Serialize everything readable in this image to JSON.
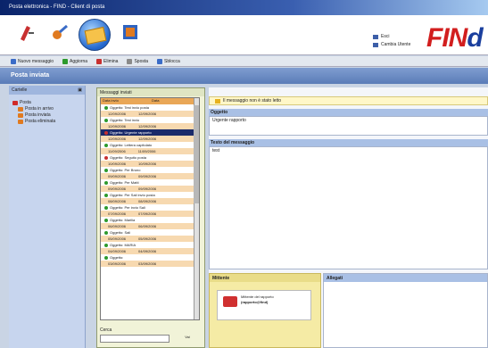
{
  "window": {
    "title": "Posta elettronica - FIND - Client di posta"
  },
  "toolbar": {
    "icons": [
      "compose-icon",
      "key-icon",
      "globe-mail-icon",
      "film-icon"
    ],
    "links": [
      "Esci",
      "Cambia Utente"
    ]
  },
  "logo": {
    "text_red": "FIN",
    "text_blue": "d"
  },
  "menu": {
    "items": [
      {
        "label": "Nuovo messaggio",
        "icon": "new-message-icon",
        "color": "#3b6cc7"
      },
      {
        "label": "Aggiorna",
        "icon": "refresh-icon",
        "color": "#2d9a2d"
      },
      {
        "label": "Elimina",
        "icon": "delete-icon",
        "color": "#c83030"
      },
      {
        "label": "Sposta",
        "icon": "move-icon",
        "color": "#8a8a8a"
      },
      {
        "label": "Sblocca",
        "icon": "unlock-icon",
        "color": "#3b6cc7"
      }
    ]
  },
  "page": {
    "title": "Posta inviata"
  },
  "sidebar": {
    "header": "Cartelle",
    "tree": [
      {
        "label": "Posta",
        "level": 0,
        "color": "#d02a2a"
      },
      {
        "label": "Posta in arrivo",
        "level": 1,
        "color": "#e07a20"
      },
      {
        "label": "Posta inviata",
        "level": 1,
        "color": "#e07a20"
      },
      {
        "label": "Posta eliminata",
        "level": 1,
        "color": "#e07a20"
      }
    ]
  },
  "messages": {
    "header": "Messaggi inviati",
    "columns": [
      "Data invio",
      "Data"
    ],
    "rows": [
      {
        "subject": "Oggetto: Test invio posta",
        "date1": "12/09/2006",
        "date2": "12/09/2006",
        "dot": "#2d9a2d"
      },
      {
        "subject": "Oggetto: Test invio",
        "date1": "12/09/2006",
        "date2": "12/09/2006",
        "dot": "#2d9a2d"
      },
      {
        "subject": "Oggetto: Urgente rapporto",
        "date1": "12/09/2006",
        "date2": "12/09/2006",
        "dot": "#c83030",
        "selected": true
      },
      {
        "subject": "Oggetto: Lettera capitolato",
        "date1": "11/09/2006",
        "date2": "11/09/2006",
        "dot": "#2d9a2d"
      },
      {
        "subject": "Oggetto: Seguito posta",
        "date1": "10/09/2006",
        "date2": "10/09/2006",
        "dot": "#c83030"
      },
      {
        "subject": "Oggetto: Per Bruno",
        "date1": "09/09/2006",
        "date2": "09/09/2006",
        "dot": "#2d9a2d"
      },
      {
        "subject": "Oggetto: Per Matti",
        "date1": "09/09/2006",
        "date2": "09/09/2006",
        "dot": "#2d9a2d"
      },
      {
        "subject": "Oggetto: Per Sali invio posta",
        "date1": "08/09/2006",
        "date2": "08/09/2006",
        "dot": "#2d9a2d"
      },
      {
        "subject": "Oggetto: Per invio Sali",
        "date1": "07/09/2006",
        "date2": "07/09/2006",
        "dot": "#2d9a2d"
      },
      {
        "subject": "Oggetto: Marilia",
        "date1": "06/09/2006",
        "date2": "06/09/2006",
        "dot": "#2d9a2d"
      },
      {
        "subject": "Oggetto: Sali",
        "date1": "05/09/2006",
        "date2": "05/09/2006",
        "dot": "#2d9a2d"
      },
      {
        "subject": "Oggetto: MARIA",
        "date1": "04/09/2006",
        "date2": "04/09/2006",
        "dot": "#2d9a2d"
      },
      {
        "subject": "Oggetto:",
        "date1": "03/09/2006",
        "date2": "03/09/2006",
        "dot": "#2d9a2d"
      }
    ],
    "search_label": "Cerca",
    "search_button": "Vai"
  },
  "detail": {
    "info_bar": "Il messaggio non è stato letto",
    "subject_label": "Oggetto",
    "subject_value": "Urgente rapporto",
    "body_label": "Testo del messaggio",
    "body_value": "test",
    "sender_label": "Mittente",
    "sender_line1": "Mittente del rapporto",
    "sender_line2": "(rapporto@find)",
    "attachments_label": "Allegati"
  }
}
